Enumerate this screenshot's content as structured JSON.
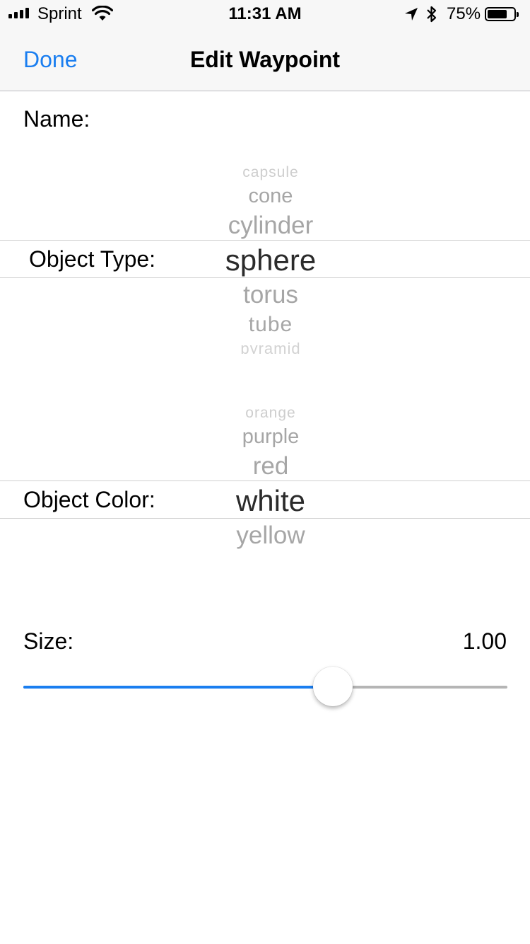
{
  "status_bar": {
    "carrier": "Sprint",
    "time": "11:31 AM",
    "battery": "75%",
    "battery_level": 0.75,
    "signal_bars": 4,
    "icons": [
      "signal-icon",
      "wifi-icon",
      "location-arrow-icon",
      "bluetooth-icon",
      "battery-icon"
    ]
  },
  "nav": {
    "done_label": "Done",
    "title": "Edit Waypoint"
  },
  "form": {
    "name_label": "Name:",
    "name_value": "",
    "object_type_label": "Object Type:",
    "object_color_label": "Object Color:",
    "size_label": "Size:",
    "size_value": "1.00",
    "size_slider_fraction": 0.64
  },
  "object_type_picker": {
    "visible_options": [
      "capsule",
      "cone",
      "cylinder",
      "sphere",
      "torus",
      "tube",
      "pyramid"
    ],
    "selected": "sphere"
  },
  "object_color_picker": {
    "visible_options": [
      "orange",
      "purple",
      "red",
      "white",
      "yellow"
    ],
    "selected": "white"
  },
  "colors": {
    "accent": "#1a7ef0",
    "bar_background": "#f7f7f7",
    "picker_unselected": "#a6a6a6",
    "picker_selected": "#2b2b2b",
    "slider_track": "#b5b5b5"
  }
}
